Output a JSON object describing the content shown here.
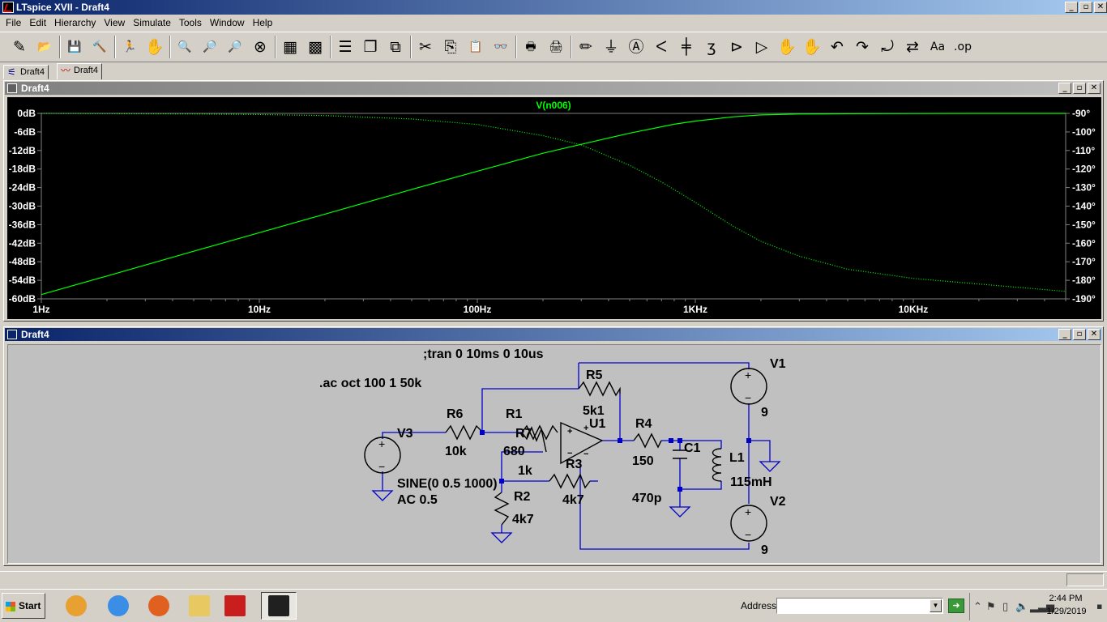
{
  "app": {
    "title": "LTspice XVII - Draft4"
  },
  "window_buttons": [
    "_",
    "▫",
    "✕"
  ],
  "menu": [
    {
      "label": "File"
    },
    {
      "label": "Edit"
    },
    {
      "label": "Hierarchy"
    },
    {
      "label": "View"
    },
    {
      "label": "Simulate"
    },
    {
      "label": "Tools"
    },
    {
      "label": "Window"
    },
    {
      "label": "Help"
    }
  ],
  "toolbar": [
    {
      "name": "new-schematic-icon",
      "glyph": "✎"
    },
    {
      "name": "open-icon",
      "glyph": "📂"
    },
    {
      "name": "save-icon",
      "glyph": "💾"
    },
    {
      "name": "control-panel-icon",
      "glyph": "🔨"
    },
    {
      "name": "run-icon",
      "glyph": "🏃"
    },
    {
      "name": "halt-icon",
      "glyph": "✋"
    },
    {
      "name": "zoom-in-icon",
      "glyph": "🔍"
    },
    {
      "name": "pan-icon",
      "glyph": "🔎"
    },
    {
      "name": "zoom-out-icon",
      "glyph": "🔎"
    },
    {
      "name": "zoom-fit-icon",
      "glyph": "⊗"
    },
    {
      "name": "autorange-icon",
      "glyph": "▦"
    },
    {
      "name": "delete-traces-icon",
      "glyph": "▩"
    },
    {
      "name": "tile-horizontal-icon",
      "glyph": "☰"
    },
    {
      "name": "cascade-icon",
      "glyph": "❐"
    },
    {
      "name": "tile-vertical-icon",
      "glyph": "⧉"
    },
    {
      "name": "cut-icon",
      "glyph": "✂"
    },
    {
      "name": "copy-icon",
      "glyph": "⎘"
    },
    {
      "name": "paste-icon",
      "glyph": "📋"
    },
    {
      "name": "find-icon",
      "glyph": "👓"
    },
    {
      "name": "print-icon",
      "glyph": "🖶"
    },
    {
      "name": "print-preview-icon",
      "glyph": "🖨"
    },
    {
      "name": "draw-wire-icon",
      "glyph": "✏"
    },
    {
      "name": "ground-icon",
      "glyph": "⏚"
    },
    {
      "name": "label-net-icon",
      "glyph": "Ⓐ"
    },
    {
      "name": "resistor-icon",
      "glyph": "ᐸ"
    },
    {
      "name": "capacitor-icon",
      "glyph": "╪"
    },
    {
      "name": "inductor-icon",
      "glyph": "ʒ"
    },
    {
      "name": "diode-icon",
      "glyph": "⊳"
    },
    {
      "name": "component-icon",
      "glyph": "▷"
    },
    {
      "name": "move-icon",
      "glyph": "✋"
    },
    {
      "name": "drag-icon",
      "glyph": "✋"
    },
    {
      "name": "undo-icon",
      "glyph": "↶"
    },
    {
      "name": "redo-icon",
      "glyph": "↷"
    },
    {
      "name": "rotate-icon",
      "glyph": "⤾"
    },
    {
      "name": "mirror-icon",
      "glyph": "⇄"
    },
    {
      "name": "text-icon",
      "glyph": "Aa"
    },
    {
      "name": "spice-directive-icon",
      "glyph": ".op"
    }
  ],
  "tabs": [
    {
      "label": "Draft4",
      "icon": "schematic-tab-icon"
    },
    {
      "label": "Draft4",
      "icon": "waveform-tab-icon"
    }
  ],
  "plot_window": {
    "title": "Draft4"
  },
  "schematic_window": {
    "title": "Draft4"
  },
  "chart_data": {
    "type": "line",
    "title": "V(n006)",
    "x_scale": "log",
    "x_ticks": [
      "1Hz",
      "10Hz",
      "100Hz",
      "1KHz",
      "10KHz"
    ],
    "xlim_hz": [
      1,
      50000
    ],
    "y_left_ticks": [
      "0dB",
      "-6dB",
      "-12dB",
      "-18dB",
      "-24dB",
      "-30dB",
      "-36dB",
      "-42dB",
      "-48dB",
      "-54dB",
      "-60dB"
    ],
    "ylim_left_db": [
      -60,
      0
    ],
    "y_right_ticks": [
      "-90°",
      "-100°",
      "-110°",
      "-120°",
      "-130°",
      "-140°",
      "-150°",
      "-160°",
      "-170°",
      "-180°",
      "-190°"
    ],
    "ylim_right_deg": [
      -190,
      -90
    ],
    "series": [
      {
        "name": "V(n006)",
        "style": "solid",
        "color": "#00ff00",
        "unit": "dB",
        "x": [
          1,
          2,
          5,
          10,
          20,
          50,
          100,
          200,
          300,
          500,
          800,
          1000,
          1500,
          2000,
          3000,
          5000,
          10000,
          20000,
          50000
        ],
        "y": [
          -58.6,
          -52.6,
          -44.6,
          -38.6,
          -32.6,
          -24.6,
          -18.7,
          -12.9,
          -10.0,
          -6.4,
          -3.5,
          -2.5,
          -1.1,
          -0.5,
          -0.2,
          -0.1,
          -0.05,
          0,
          0
        ]
      },
      {
        "name": "phase",
        "style": "dotted",
        "color": "#00ff00",
        "unit": "deg",
        "x": [
          1,
          5,
          10,
          20,
          50,
          100,
          200,
          300,
          500,
          700,
          1000,
          1500,
          2000,
          3000,
          5000,
          10000,
          20000,
          50000
        ],
        "y": [
          -90,
          -90.3,
          -90.6,
          -91.2,
          -93,
          -96,
          -102,
          -107,
          -118,
          -127,
          -138,
          -151,
          -159,
          -167,
          -174,
          -179,
          -182,
          -186
        ]
      }
    ]
  },
  "schematic": {
    "directives": [
      ";tran 0 10ms 0 10us",
      ".ac oct 100 1 50k"
    ],
    "labels": {
      "V1": "V1",
      "V1_val": "9",
      "V2": "V2",
      "V2_val": "9",
      "V3": "V3",
      "V3_val1": "SINE(0 0.5 1000)",
      "V3_val2": "AC 0.5",
      "R1": "R1",
      "R1_val": "680",
      "R2": "R2",
      "R2_val": "4k7",
      "R3": "R3",
      "R3_val": "4k7",
      "R4": "R4",
      "R4_val": "150",
      "R5": "R5",
      "R5_val": "5k1",
      "R6": "R6",
      "R6_val": "10k",
      "R7": "R7",
      "R7_val": "1k",
      "U1": "U1",
      "C1": "C1",
      "C1_val": "470p",
      "L1": "L1",
      "L1_val": "115mH"
    }
  },
  "taskbar": {
    "start_label": "Start",
    "apps": [
      {
        "name": "media-player-icon",
        "color": "#e8a030"
      },
      {
        "name": "internet-explorer-icon",
        "color": "#3a8ee6"
      },
      {
        "name": "firefox-icon",
        "color": "#e06020"
      },
      {
        "name": "file-explorer-icon",
        "color": "#e8c860"
      },
      {
        "name": "acrobat-icon",
        "color": "#c81e1e"
      },
      {
        "name": "ltspice-taskbar-icon",
        "color": "#202020"
      }
    ],
    "address_label": "Address",
    "address_value": "",
    "clock_time": "2:44 PM",
    "clock_date": "1/29/2019"
  }
}
